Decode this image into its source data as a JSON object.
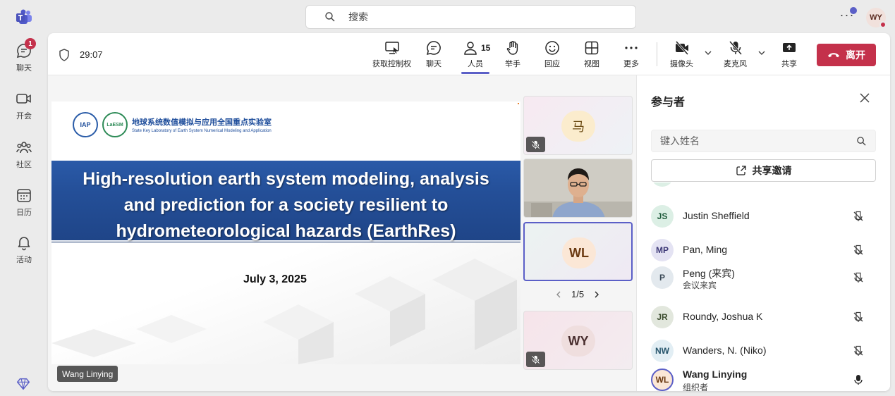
{
  "rail": {
    "items": [
      {
        "label": "聊天",
        "badge": "1"
      },
      {
        "label": "开会"
      },
      {
        "label": "社区"
      },
      {
        "label": "日历"
      },
      {
        "label": "活动"
      }
    ]
  },
  "search": {
    "placeholder": "搜索"
  },
  "user_avatar": "WY",
  "meeting": {
    "timer": "29:07",
    "toolbar": {
      "take_control": "获取控制权",
      "chat": "聊天",
      "people": "人员",
      "people_count": "15",
      "raise_hand": "举手",
      "react": "回应",
      "view": "视图",
      "more": "更多",
      "camera": "摄像头",
      "mic": "麦克风",
      "share": "共享",
      "leave": "离开"
    },
    "slide": {
      "lab_cn": "地球系统数值模拟与应用全国重点实验室",
      "lab_en": "State Key Laboratory of Earth System Numerical Modeling and Application",
      "logo1": "IAP",
      "logo2": "LaESM",
      "title_line1": "High-resolution earth system modeling, analysis",
      "title_line2": "and prediction for a society resilient to",
      "title_line3": "hydrometeorological hazards (EarthRes)",
      "date": "July 3, 2025"
    },
    "presenter_name": "Wang Linying",
    "tiles": [
      {
        "initials": "马",
        "muted": true
      },
      {
        "video": true
      },
      {
        "initials": "WL",
        "selected": true
      },
      {
        "initials": "WY",
        "muted": true
      }
    ],
    "pager": "1/5"
  },
  "panel": {
    "title": "参与者",
    "search_placeholder": "键入姓名",
    "share_invite": "共享邀请",
    "participants": [
      {
        "initials": "JS",
        "name": "Justin Sheffield",
        "sub": "",
        "muted": true,
        "color": "#dcefe5",
        "fg": "#1d5a3a"
      },
      {
        "initials": "MP",
        "name": "Pan, Ming",
        "sub": "",
        "muted": true,
        "color": "#e4e3f3",
        "fg": "#3e3a78"
      },
      {
        "initials": "P",
        "name": "Peng (来宾)",
        "sub": "会议来宾",
        "muted": true,
        "color": "#e3e9ee",
        "fg": "#3b4a57"
      },
      {
        "initials": "JR",
        "name": "Roundy, Joshua K",
        "sub": "",
        "muted": true,
        "color": "#e2e7dd",
        "fg": "#3f4f31"
      },
      {
        "initials": "NW",
        "name": "Wanders, N. (Niko)",
        "sub": "",
        "muted": true,
        "color": "#e2eef4",
        "fg": "#25546b"
      },
      {
        "initials": "WL",
        "name": "Wang Linying",
        "sub": "组织者",
        "muted": false,
        "color": "#fbe7d6",
        "fg": "#6b3a12",
        "bold": true
      }
    ]
  }
}
